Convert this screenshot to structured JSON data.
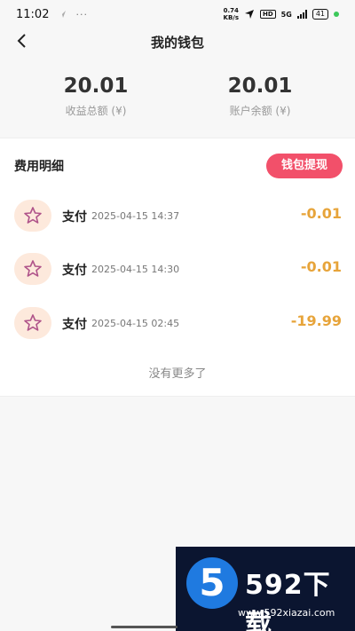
{
  "status_bar": {
    "time": "11:02",
    "dots": "···",
    "net_speed": "0.74",
    "net_unit": "KB/s",
    "hd": "HD",
    "network": "5G",
    "battery": "41"
  },
  "header": {
    "title": "我的钱包"
  },
  "summary": {
    "total_income_value": "20.01",
    "total_income_label": "收益总额 (¥)",
    "balance_value": "20.01",
    "balance_label": "账户余额 (¥)"
  },
  "details": {
    "title": "费用明细",
    "withdraw_label": "钱包提现",
    "rows": [
      {
        "label": "支付",
        "time": "2025-04-15 14:37",
        "amount": "-0.01"
      },
      {
        "label": "支付",
        "time": "2025-04-15 14:30",
        "amount": "-0.01"
      },
      {
        "label": "支付",
        "time": "2025-04-15 02:45",
        "amount": "-19.99"
      }
    ],
    "no_more": "没有更多了"
  },
  "watermark": {
    "digit": "5",
    "text": "592下载",
    "url": "www.592xiazai.com"
  },
  "colors": {
    "accent": "#f2506a",
    "amount": "#e7a43a",
    "star": "#b0548a",
    "icon_bg": "#fde9dc"
  },
  "icons": [
    "back-arrow-icon",
    "star-icon",
    "location-arrow-icon",
    "signal-icon",
    "battery-icon"
  ]
}
